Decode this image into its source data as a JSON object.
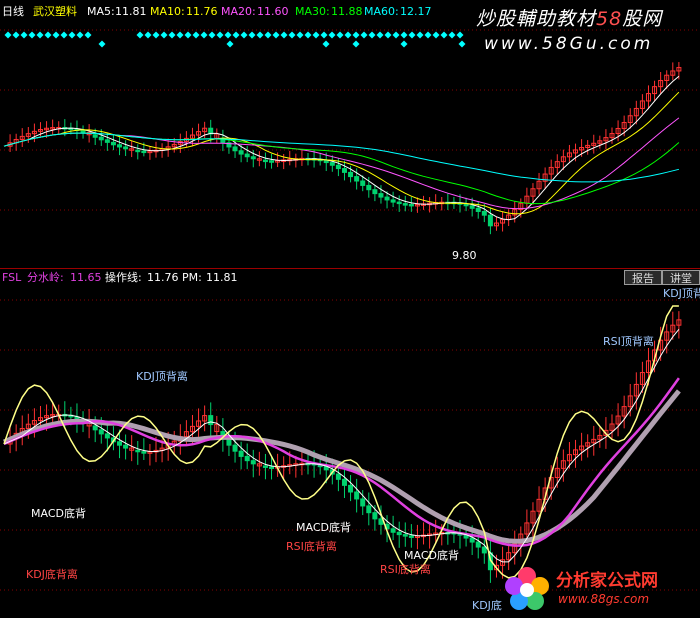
{
  "top_header": {
    "period": "日线",
    "stock": "武汉塑料",
    "ma5_label": "MA5:",
    "ma5_value": "11.81",
    "ma10_label": "MA10:",
    "ma10_value": "11.76",
    "ma20_label": "MA20:",
    "ma20_value": "11.60",
    "ma30_label": "MA30:",
    "ma30_value": "11.88",
    "ma60_label": "MA60:",
    "ma60_value": "12.17"
  },
  "bottom_header": {
    "indicator": "FSL",
    "fsx_label": "分水岭:",
    "fsx_value": "11.65",
    "czx_label": "操作线:",
    "czx_value": "11.76",
    "pm_label": "PM:",
    "pm_value": "11.81"
  },
  "buttons": {
    "report": "报告",
    "explain": "讲堂"
  },
  "watermark": {
    "line1_a": "炒股輔助教材",
    "line1_b": "58",
    "line1_c": "股网",
    "line2": "www.58Gu.com"
  },
  "logo": {
    "title": "分析家公式网",
    "url": "www.88gs.com"
  },
  "colors": {
    "background": "#000000",
    "up": "#ff3232",
    "down": "#00d26e",
    "grid": "#8a0000",
    "ma5": "#ffffff",
    "ma10": "#ffff00",
    "ma20": "#ff55ff",
    "ma30": "#00ff00",
    "ma60": "#00ffff",
    "fsl": "#e040e0",
    "operation": "#ffff88",
    "pm": "#ffffff",
    "band": "#b0a0b0",
    "signal_blue": "#a0c8ff",
    "signal_red": "#ff4444",
    "signal_white": "#ffffff",
    "diamond": "#00ffff"
  },
  "chart_data": [
    {
      "type": "candlestick",
      "panel": "price",
      "series": [
        {
          "name": "MA5",
          "value": 11.81
        },
        {
          "name": "MA10",
          "value": 11.76
        },
        {
          "name": "MA20",
          "value": 11.6
        },
        {
          "name": "MA30",
          "value": 11.88
        },
        {
          "name": "MA60",
          "value": 12.17
        }
      ],
      "annotations": [
        {
          "text": "9.80",
          "kind": "low"
        }
      ]
    },
    {
      "type": "line",
      "panel": "indicator",
      "title": "FSL",
      "series": [
        {
          "name": "分水岭",
          "value": 11.65
        },
        {
          "name": "操作线",
          "value": 11.76
        },
        {
          "name": "PM",
          "value": 11.81
        }
      ],
      "signals": [
        {
          "text": "KDJ顶背离",
          "color": "signal_blue"
        },
        {
          "text": "MACD底背",
          "color": "signal_white"
        },
        {
          "text": "KDJ底背离",
          "color": "signal_red"
        },
        {
          "text": "MACD底背",
          "color": "signal_white"
        },
        {
          "text": "RSI底背离",
          "color": "signal_red"
        },
        {
          "text": "MACD底背",
          "color": "signal_white"
        },
        {
          "text": "RSI底背离",
          "color": "signal_red"
        },
        {
          "text": "KDJ底",
          "color": "signal_blue"
        },
        {
          "text": "RSI顶背离",
          "color": "signal_blue"
        },
        {
          "text": "KDJ顶背",
          "color": "signal_blue"
        }
      ]
    }
  ]
}
